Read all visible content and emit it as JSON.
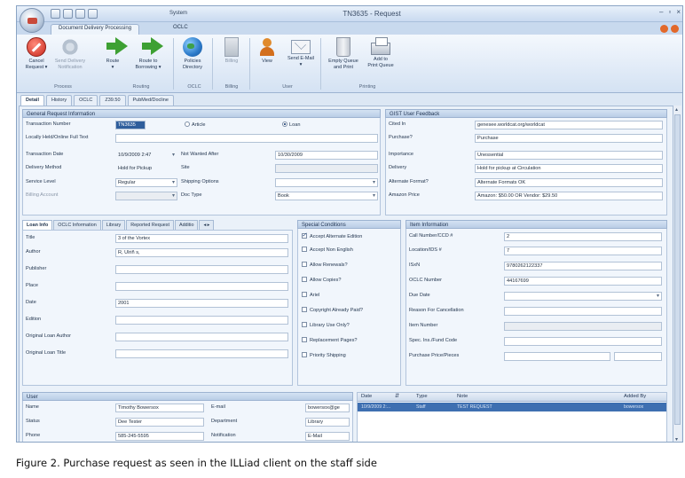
{
  "window": {
    "title": "TN3635 - Request",
    "system_label": "System",
    "controls": [
      "–",
      "▫",
      "×"
    ]
  },
  "ribbon_tabs": [
    "Document Delivery Processing",
    "OCLC"
  ],
  "ribbon": {
    "buttons": [
      {
        "label": "Cancel\nRequest ▾",
        "icon": "cancel-icon",
        "enabled": true
      },
      {
        "label": "Send Delivery\nNotification",
        "icon": "gear-icon",
        "enabled": false
      },
      {
        "label": "Route\n▾",
        "icon": "route-arrow-icon",
        "enabled": true
      },
      {
        "label": "Route to\nBorrowing ▾",
        "icon": "route-arrow-icon",
        "enabled": true
      },
      {
        "label": "Policies\nDirectory",
        "icon": "globe-icon",
        "enabled": true
      },
      {
        "label": "Billing",
        "icon": "billing-icon",
        "enabled": false
      },
      {
        "label": "View",
        "icon": "person-icon",
        "enabled": true
      },
      {
        "label": "Send E-Mail\n▾",
        "icon": "mail-icon",
        "enabled": true
      },
      {
        "label": "Empty Queue\nand Print",
        "icon": "trash-icon",
        "enabled": true
      },
      {
        "label": "Add to\nPrint Queue",
        "icon": "printer-icon",
        "enabled": true
      }
    ],
    "groups": [
      "Process",
      "Routing",
      "OCLC",
      "Billing",
      "User",
      "Printing"
    ]
  },
  "content_tabs": [
    "Detail",
    "History",
    "OCLC",
    "Z39.50",
    "PubMed/Docline"
  ],
  "general": {
    "header": "General Request Information",
    "transaction_number_label": "Transaction Number",
    "transaction_number": "TN3635",
    "radio_article": "Article",
    "radio_loan": "Loan",
    "local_hold_label": "Locally Held/Online Full Text",
    "local_hold": "",
    "transaction_date_label": "Transaction Date",
    "transaction_date": "10/9/2009 2:47",
    "not_wanted_label": "Not Wanted After",
    "not_wanted": "10/30/2009",
    "delivery_method_label": "Delivery Method",
    "delivery_method": "Hold for Pickup",
    "site_label": "Site",
    "site": "",
    "service_level_label": "Service Level",
    "service_level": "Regular",
    "shipping_label": "Shipping Options",
    "shipping": "",
    "billing_label": "Billing Account",
    "billing": "",
    "doctype_label": "Doc Type",
    "doctype": "Book"
  },
  "gist": {
    "header": "GIST User Feedback",
    "rows": [
      {
        "label": "Cited In",
        "value": "genesee.worldcat.org/worldcat"
      },
      {
        "label": "Purchase?",
        "value": "Purchase"
      },
      {
        "label": "Importance",
        "value": "Unessential"
      },
      {
        "label": "Delivery",
        "value": "Hold for pickup at Circulation"
      },
      {
        "label": "Alternate Format?",
        "value": "Alternate Formats OK"
      },
      {
        "label": "Amazon Price",
        "value": "Amazon: $50.00 OR Vendor: $29.50"
      }
    ]
  },
  "loan_tabs": [
    "Loan Info",
    "OCLC Information",
    "Library",
    "Reported Request",
    "Additio"
  ],
  "loan": {
    "rows": [
      {
        "label": "Title",
        "value": "3 of the Vortex"
      },
      {
        "label": "Author",
        "value": "R, Ulriñ s,"
      },
      {
        "label": "Publisher",
        "value": ""
      },
      {
        "label": "Place",
        "value": ""
      },
      {
        "label": "Date",
        "value": "2001"
      },
      {
        "label": "Edition",
        "value": ""
      },
      {
        "label": "Original Loan Author",
        "value": ""
      },
      {
        "label": "Original Loan Title",
        "value": ""
      }
    ]
  },
  "special": {
    "header": "Special Conditions",
    "items": [
      {
        "label": "Accept Alternate Edition",
        "checked": true
      },
      {
        "label": "Accept Non English",
        "checked": false
      },
      {
        "label": "Allow Renewals?",
        "checked": false
      },
      {
        "label": "Allow Copies?",
        "checked": false
      },
      {
        "label": "Ariel",
        "checked": false
      },
      {
        "label": "Copyright Already Paid?",
        "checked": false
      },
      {
        "label": "Library Use Only?",
        "checked": false
      },
      {
        "label": "Replacement Pages?",
        "checked": false
      },
      {
        "label": "Priority Shipping",
        "checked": false
      }
    ]
  },
  "item": {
    "header": "Item Information",
    "rows": [
      {
        "label": "Call Number/CCD #",
        "value": "2"
      },
      {
        "label": "Location/IDS #",
        "value": "7"
      },
      {
        "label": "ISxN",
        "value": "9780262122337"
      },
      {
        "label": "OCLC Number",
        "value": "44167699"
      },
      {
        "label": "Due Date",
        "value": ""
      },
      {
        "label": "Reason For Cancellation",
        "value": ""
      },
      {
        "label": "Item Number",
        "value": ""
      },
      {
        "label": "Spec. Ins./Fund Code",
        "value": ""
      },
      {
        "label": "Purchase Price/Pieces",
        "value": ""
      }
    ]
  },
  "user": {
    "header": "User",
    "rows": [
      {
        "label": "Name",
        "value": "Timothy Bowersox",
        "label2": "E-mail",
        "value2": "bowersox@ge"
      },
      {
        "label": "Status",
        "value": "Dee Tester",
        "label2": "Department",
        "value2": "Library"
      },
      {
        "label": "Phone",
        "value": "585-245-5595",
        "label2": "Notification",
        "value2": "E-Mail"
      }
    ]
  },
  "notes": {
    "columns": [
      "Date",
      "Type",
      "Note",
      "Added By"
    ],
    "rows": [
      {
        "date": "10/9/2009 2:...",
        "type": "Staff",
        "note": "TEST REQUEST",
        "added_by": "bowersox"
      }
    ]
  },
  "caption": "Figure 2. Purchase request as seen in the ILLiad client on the staff side"
}
